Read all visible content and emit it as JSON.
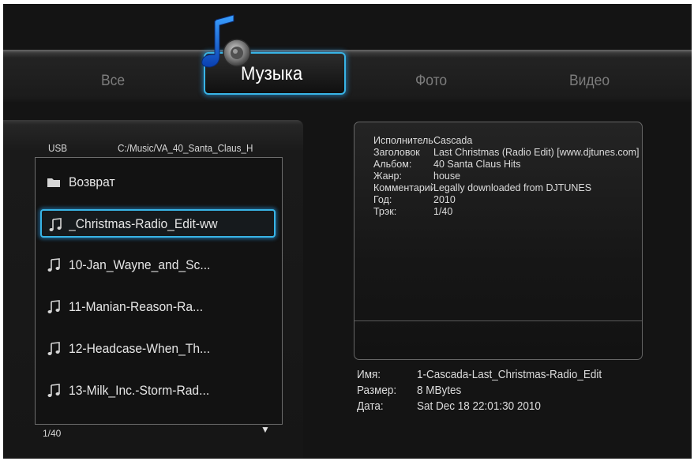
{
  "tabs": {
    "all": "Все",
    "music": "Музыка",
    "photo": "Фото",
    "video": "Видео"
  },
  "browser": {
    "source": "USB",
    "path": "C:/Music/VA_40_Santa_Claus_H",
    "items": [
      {
        "label": "Возврат",
        "icon": "folder-icon"
      },
      {
        "label": "_Christmas-Radio_Edit-ww",
        "icon": "music-note-icon"
      },
      {
        "label": "10-Jan_Wayne_and_Sc...",
        "icon": "music-note-icon"
      },
      {
        "label": "11-Manian-Reason-Ra...",
        "icon": "music-note-icon"
      },
      {
        "label": "12-Headcase-When_Th...",
        "icon": "music-note-icon"
      },
      {
        "label": "13-Milk_Inc.-Storm-Rad...",
        "icon": "music-note-icon"
      }
    ],
    "position": "1/40",
    "scroll_indicator": "▼"
  },
  "metadata": {
    "rows": [
      {
        "key": "Исполнитель",
        "value": "Cascada"
      },
      {
        "key": "Заголовок",
        "value": "Last Christmas (Radio Edit) [www.djtunes.com]"
      },
      {
        "key": "Альбом:",
        "value": "40 Santa Claus Hits"
      },
      {
        "key": "Жанр:",
        "value": "house"
      },
      {
        "key": "Комментарий",
        "value": "Legally downloaded from DJTUNES"
      },
      {
        "key": "Год:",
        "value": "2010"
      },
      {
        "key": "Трэк:",
        "value": "1/40"
      }
    ]
  },
  "file": {
    "name_label": "Имя:",
    "name": "1-Cascada-Last_Christmas-Radio_Edit",
    "size_label": "Размер:",
    "size": "8 MBytes",
    "date_label": "Дата:",
    "date": "Sat Dec 18 22:01:30 2010"
  },
  "colors": {
    "accent": "#38b4e6",
    "background": "#141414"
  }
}
